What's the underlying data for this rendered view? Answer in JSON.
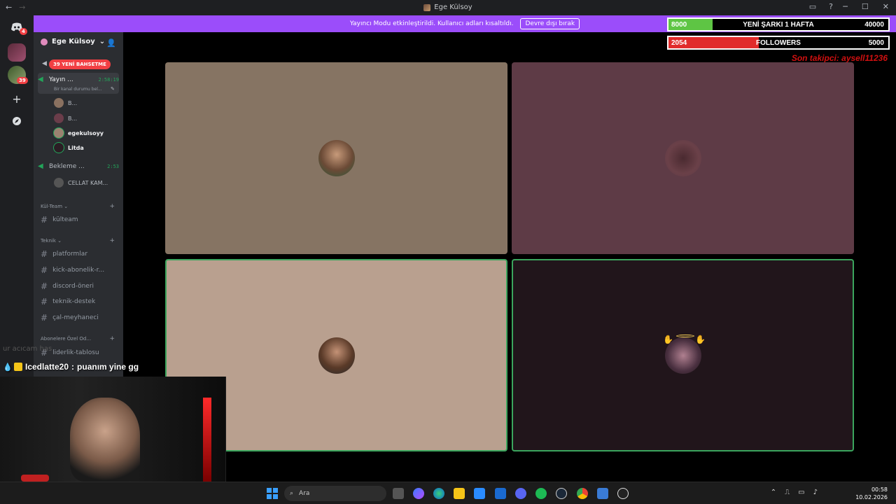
{
  "window": {
    "title": "Ege Külsoy",
    "back": "←",
    "forward": "→"
  },
  "banner": {
    "message": "Yayıncı Modu etkinleştirildi. Kullanıcı adları kısaltıldı.",
    "button": "Devre dışı bırak"
  },
  "guilds": {
    "discord_badge": "4",
    "server_badge": "39"
  },
  "sidebar": {
    "server_name": "Ege Külsoy",
    "chevron": "⌄",
    "mentions_pill": "39 YENİ BAHSETME",
    "voice_channels": [
      {
        "name": "Yayın ...",
        "timer": "2:58:19",
        "status": "Bir kanal durumu bel..."
      },
      {
        "name": "Bekleme ...",
        "timer": "2:53"
      }
    ],
    "members": [
      {
        "name": "B..."
      },
      {
        "name": "B..."
      },
      {
        "name": "egekulsoyy"
      },
      {
        "name": "Litda"
      },
      {
        "name": "CELLAT KAM..."
      }
    ],
    "categories": [
      {
        "name": "Kül-Team ⌄",
        "channels": [
          "külteam"
        ]
      },
      {
        "name": "Teknik ⌄",
        "channels": [
          "platformlar",
          "kick-abonelik-r...",
          "discord-öneri",
          "teknik-destek",
          "çal-meyhaneci"
        ]
      },
      {
        "name": "Abonelere Özel Od...",
        "channels": [
          "liderlik-tablosu"
        ]
      }
    ]
  },
  "overlay": {
    "song_goal": {
      "current": "8000",
      "label": "YENİ ŞARKI 1 HAFTA",
      "goal": "40000",
      "progress": 0.2,
      "color": "#5ec544"
    },
    "followers": {
      "current": "2054",
      "label": "FOLLOWERS",
      "goal": "5000",
      "progress": 0.41,
      "color": "#e12b2b"
    },
    "last_follower": "Son takipci: aysell11236"
  },
  "tiles": [
    {
      "bg": "#867463",
      "speaking": false
    },
    {
      "bg": "#5e3b46",
      "speaking": false
    },
    {
      "bg": "#b9a08f",
      "speaking": true
    },
    {
      "bg": "#21151b",
      "speaking": true
    }
  ],
  "chat": {
    "ghost": "ur acıcam has",
    "username": "Icedlatte20",
    "separator": ":",
    "message": "puanım yine gg"
  },
  "taskbar": {
    "search_placeholder": "Ara",
    "time": "00:58",
    "date": "10.02.2026"
  }
}
